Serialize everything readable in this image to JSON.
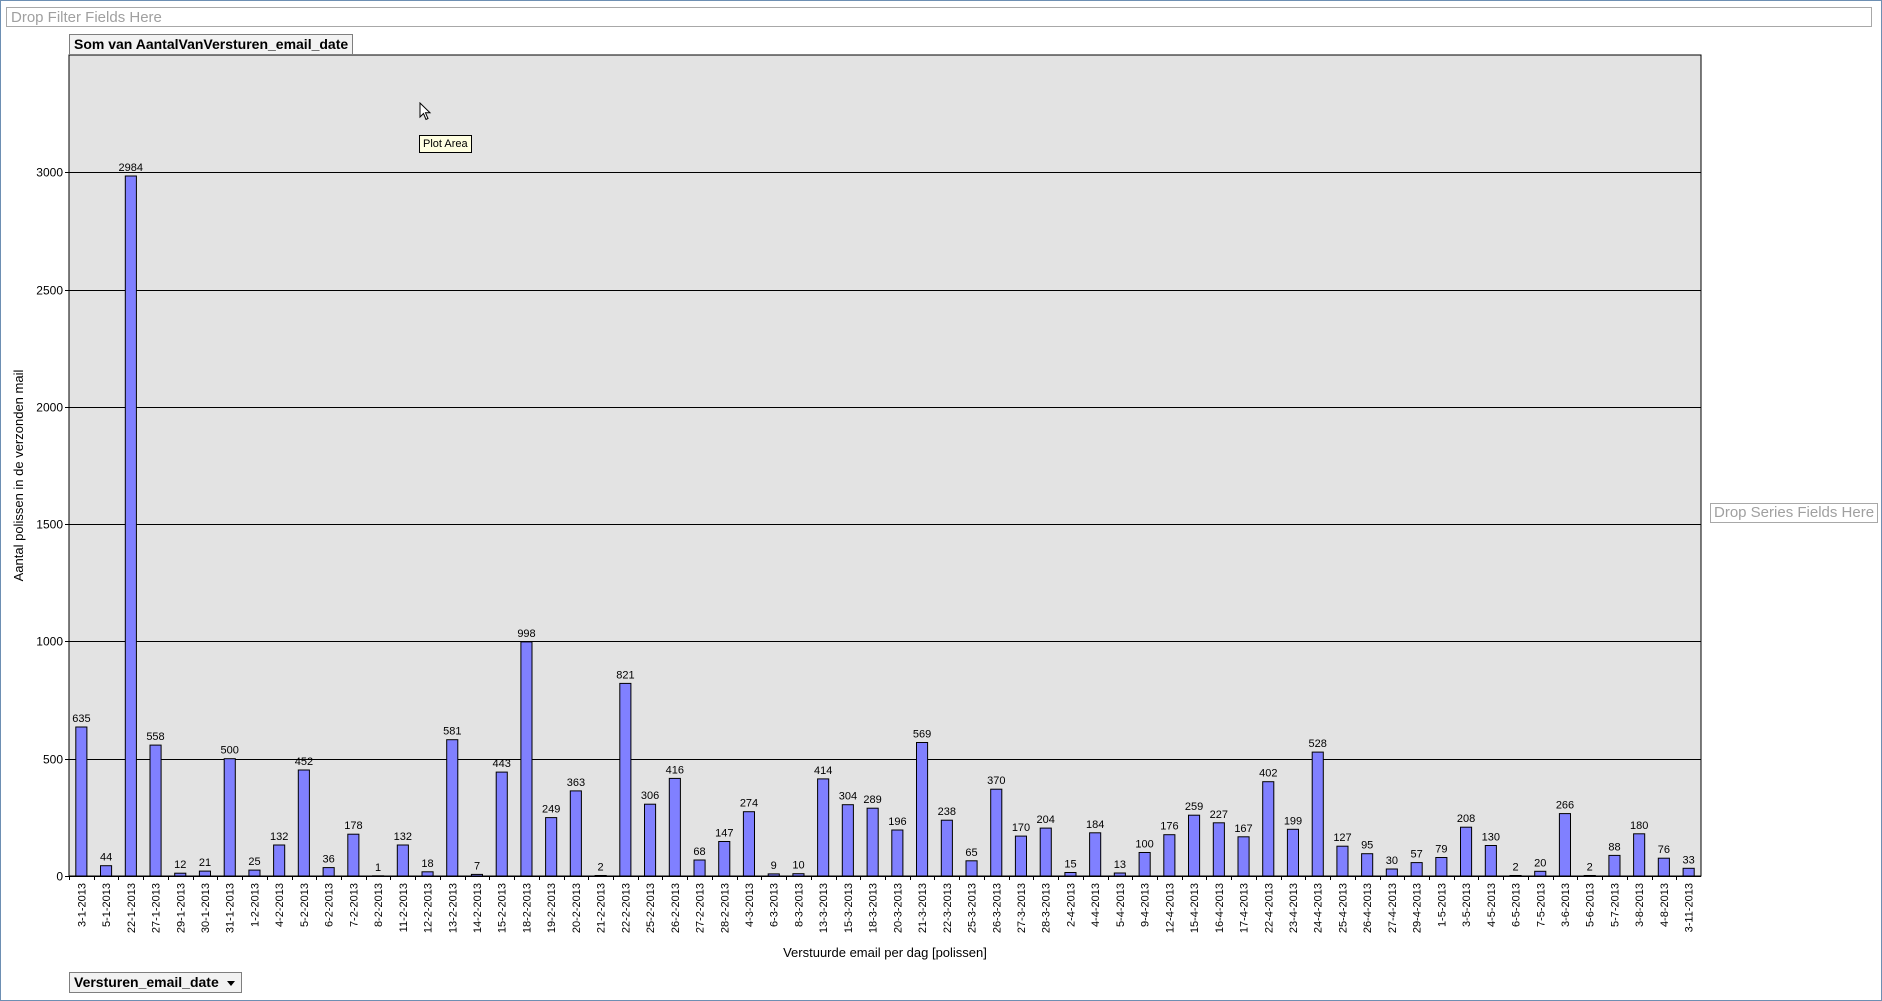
{
  "filter_drop_text": "Drop Filter Fields Here",
  "series_drop_text": "Drop Series Fields Here",
  "data_field_label": "Som van AantalVanVersturen_email_date",
  "axis_field_label": "Versturen_email_date",
  "tooltip_text": "Plot Area",
  "colors": {
    "bar_fill": "#8080ff",
    "bar_stroke": "#000000",
    "plot_bg": "#e3e3e3",
    "gridline": "#000000"
  },
  "chart_data": {
    "type": "bar",
    "title": "",
    "xlabel": "Verstuurde email per dag [polissen]",
    "ylabel": "Aantal polissen in de verzonden mail",
    "ylim": [
      0,
      3500
    ],
    "yticks": [
      0,
      500,
      1000,
      1500,
      2000,
      2500,
      3000
    ],
    "grid": true,
    "legend": "none",
    "categories": [
      "3-1-2013",
      "5-1-2013",
      "22-1-2013",
      "27-1-2013",
      "29-1-2013",
      "30-1-2013",
      "31-1-2013",
      "1-2-2013",
      "4-2-2013",
      "5-2-2013",
      "6-2-2013",
      "7-2-2013",
      "8-2-2013",
      "11-2-2013",
      "12-2-2013",
      "13-2-2013",
      "14-2-2013",
      "15-2-2013",
      "18-2-2013",
      "19-2-2013",
      "20-2-2013",
      "21-2-2013",
      "22-2-2013",
      "25-2-2013",
      "26-2-2013",
      "27-2-2013",
      "28-2-2013",
      "4-3-2013",
      "6-3-2013",
      "8-3-2013",
      "13-3-2013",
      "15-3-2013",
      "18-3-2013",
      "20-3-2013",
      "21-3-2013",
      "22-3-2013",
      "25-3-2013",
      "26-3-2013",
      "27-3-2013",
      "28-3-2013",
      "2-4-2013",
      "4-4-2013",
      "5-4-2013",
      "9-4-2013",
      "12-4-2013",
      "15-4-2013",
      "16-4-2013",
      "17-4-2013",
      "22-4-2013",
      "23-4-2013",
      "24-4-2013",
      "25-4-2013",
      "26-4-2013",
      "27-4-2013",
      "29-4-2013",
      "1-5-2013",
      "3-5-2013",
      "4-5-2013",
      "6-5-2013",
      "7-5-2013",
      "3-6-2013",
      "5-6-2013",
      "5-7-2013",
      "3-8-2013",
      "4-8-2013",
      "3-11-2013"
    ],
    "values": [
      635,
      44,
      2984,
      558,
      12,
      21,
      500,
      25,
      132,
      452,
      36,
      178,
      1,
      132,
      18,
      581,
      7,
      443,
      998,
      249,
      363,
      2,
      821,
      306,
      416,
      68,
      147,
      274,
      9,
      10,
      414,
      304,
      289,
      196,
      569,
      238,
      65,
      370,
      170,
      204,
      15,
      184,
      13,
      100,
      176,
      259,
      227,
      167,
      402,
      199,
      528,
      127,
      95,
      30,
      57,
      79,
      208,
      130,
      2,
      20,
      266,
      2,
      88,
      180,
      76,
      33
    ]
  }
}
